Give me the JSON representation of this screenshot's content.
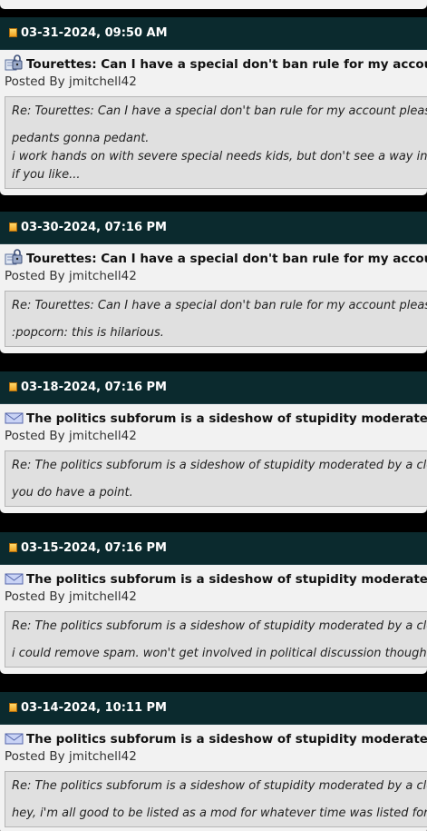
{
  "posts": [
    {
      "date": "03-31-2024, 09:50 AM",
      "icon": "lock-icon",
      "title": "Tourettes: Can I have a special don't ban rule for my account please?",
      "author": "Posted By jmitchell42",
      "quote_title": "Re: Tourettes: Can I have a special don't ban rule for my account please?",
      "lines": [
        "pedants gonna pedant.",
        "i work hands on with severe special needs kids, but don't see a way in the w",
        "if you like..."
      ]
    },
    {
      "date": "03-30-2024, 07:16 PM",
      "icon": "lock-icon",
      "title": "Tourettes: Can I have a special don't ban rule for my account please?",
      "author": "Posted By jmitchell42",
      "quote_title": "Re: Tourettes: Can I have a special don't ban rule for my account please?",
      "lines": [
        ":popcorn: this is hilarious."
      ]
    },
    {
      "date": "03-18-2024, 07:16 PM",
      "icon": "envelope-icon",
      "title": "The politics subforum is a sideshow of stupidity moderated by a clown",
      "author": "Posted By jmitchell42",
      "quote_title": "Re: The politics subforum is a sideshow of stupidity moderated by a clown",
      "lines": [
        "you do have a point."
      ]
    },
    {
      "date": "03-15-2024, 07:16 PM",
      "icon": "envelope-icon",
      "title": "The politics subforum is a sideshow of stupidity moderated by a clown",
      "author": "Posted By jmitchell42",
      "quote_title": "Re: The politics subforum is a sideshow of stupidity moderated by a clown",
      "lines": [
        "i could remove spam. won't get involved in political discussion though. spa"
      ]
    },
    {
      "date": "03-14-2024, 10:11 PM",
      "icon": "envelope-icon",
      "title": "The politics subforum is a sideshow of stupidity moderated by a clown",
      "author": "Posted By jmitchell42",
      "quote_title": "Re: The politics subforum is a sideshow of stupidity moderated by a clown",
      "lines": [
        "hey, i'm all good to be listed as a mod for whatever time was listed for the"
      ]
    }
  ]
}
